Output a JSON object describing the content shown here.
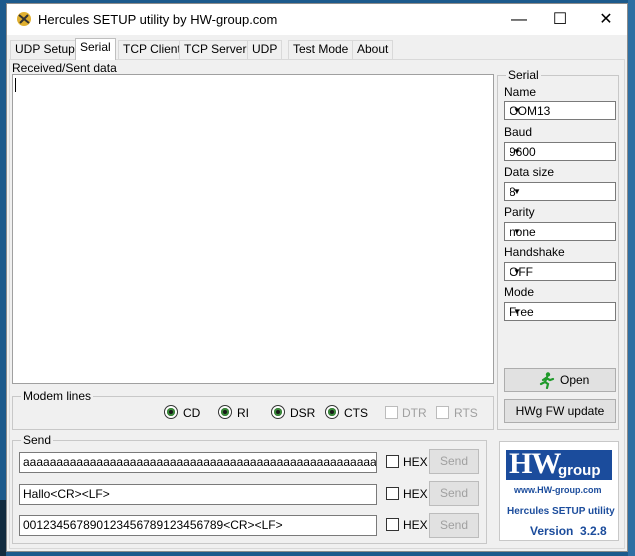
{
  "window": {
    "title": "Hercules SETUP utility by HW-group.com",
    "minimize": "—",
    "maximize": "☐",
    "close": "✕"
  },
  "tabs": [
    "UDP Setup",
    "Serial",
    "TCP Client",
    "TCP Server",
    "UDP",
    "Test Mode",
    "About"
  ],
  "received_label": "Received/Sent data",
  "serial": {
    "group_title": "Serial",
    "name_label": "Name",
    "name_value": "COM13",
    "baud_label": "Baud",
    "baud_value": "9600",
    "datasize_label": "Data size",
    "datasize_value": "8",
    "parity_label": "Parity",
    "parity_value": "none",
    "handshake_label": "Handshake",
    "handshake_value": "OFF",
    "mode_label": "Mode",
    "mode_value": "Free",
    "open_button": "Open",
    "fw_button": "HWg FW update"
  },
  "modem": {
    "group_title": "Modem lines",
    "cd": "CD",
    "ri": "RI",
    "dsr": "DSR",
    "cts": "CTS",
    "dtr": "DTR",
    "rts": "RTS"
  },
  "send": {
    "group_title": "Send",
    "hex_label": "HEX",
    "send_button": "Send",
    "line1": "aaaaaaaaaaaaaaaaaaaaaaaaaaaaaaaaaaaaaaaaaaaaaaaaaaaaaaaaaaaaaaaaa",
    "line2": "Hallo<CR><LF>",
    "line3": "001234567890123456789123456789<CR><LF>"
  },
  "logo": {
    "brand_hw": "HW",
    "brand_group": "group",
    "url": "www.HW-group.com",
    "product": "Hercules SETUP utility",
    "version": "Version  3.2.8"
  },
  "colors": {
    "accent_blue": "#1b4c9c",
    "status_green": "#3a8a3a"
  },
  "icons": {
    "app": "hercules-app-icon",
    "open": "running-man-icon",
    "dropdown": "chevron-down-icon"
  }
}
